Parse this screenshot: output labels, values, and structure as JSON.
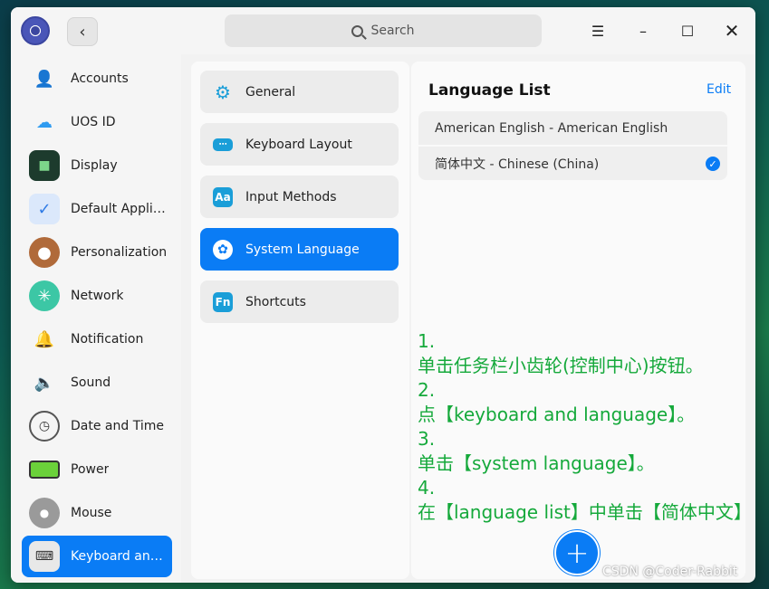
{
  "header": {
    "search_placeholder": "Search"
  },
  "sidebar": {
    "items": [
      {
        "label": "Accounts",
        "icon": "accounts-icon"
      },
      {
        "label": "UOS ID",
        "icon": "cloud-icon"
      },
      {
        "label": "Display",
        "icon": "display-icon"
      },
      {
        "label": "Default Applic...",
        "icon": "default-apps-icon"
      },
      {
        "label": "Personalization",
        "icon": "palette-icon"
      },
      {
        "label": "Network",
        "icon": "network-icon"
      },
      {
        "label": "Notification",
        "icon": "bell-icon"
      },
      {
        "label": "Sound",
        "icon": "speaker-icon"
      },
      {
        "label": "Date and Time",
        "icon": "clock-icon"
      },
      {
        "label": "Power",
        "icon": "battery-icon"
      },
      {
        "label": "Mouse",
        "icon": "mouse-icon"
      },
      {
        "label": "Keyboard and ...",
        "icon": "keyboard-icon"
      }
    ]
  },
  "middle": {
    "items": [
      {
        "label": "General",
        "icon": "gear-icon"
      },
      {
        "label": "Keyboard Layout",
        "icon": "keyboard-layout-icon"
      },
      {
        "label": "Input Methods",
        "icon": "input-methods-icon",
        "glyph": "Aa"
      },
      {
        "label": "System Language",
        "icon": "globe-icon"
      },
      {
        "label": "Shortcuts",
        "icon": "shortcuts-icon",
        "glyph": "Fn"
      }
    ]
  },
  "right": {
    "title": "Language List",
    "edit_label": "Edit",
    "languages": [
      {
        "label": "American English - American English",
        "selected": false
      },
      {
        "label": "简体中文 - Chinese (China)",
        "selected": true
      }
    ],
    "add_label": "+"
  },
  "notes": [
    "1.",
    "单击任务栏小齿轮(控制中心)按钮。",
    "2.",
    "点【keyboard  and language】。",
    "3.",
    "单击【system language】。",
    "4.",
    "在【language list】中单击【简体中文】"
  ],
  "watermark": "CSDN @Coder-Rabbit",
  "colors": {
    "accent": "#0a7cf5",
    "note_green": "#15a93b"
  }
}
